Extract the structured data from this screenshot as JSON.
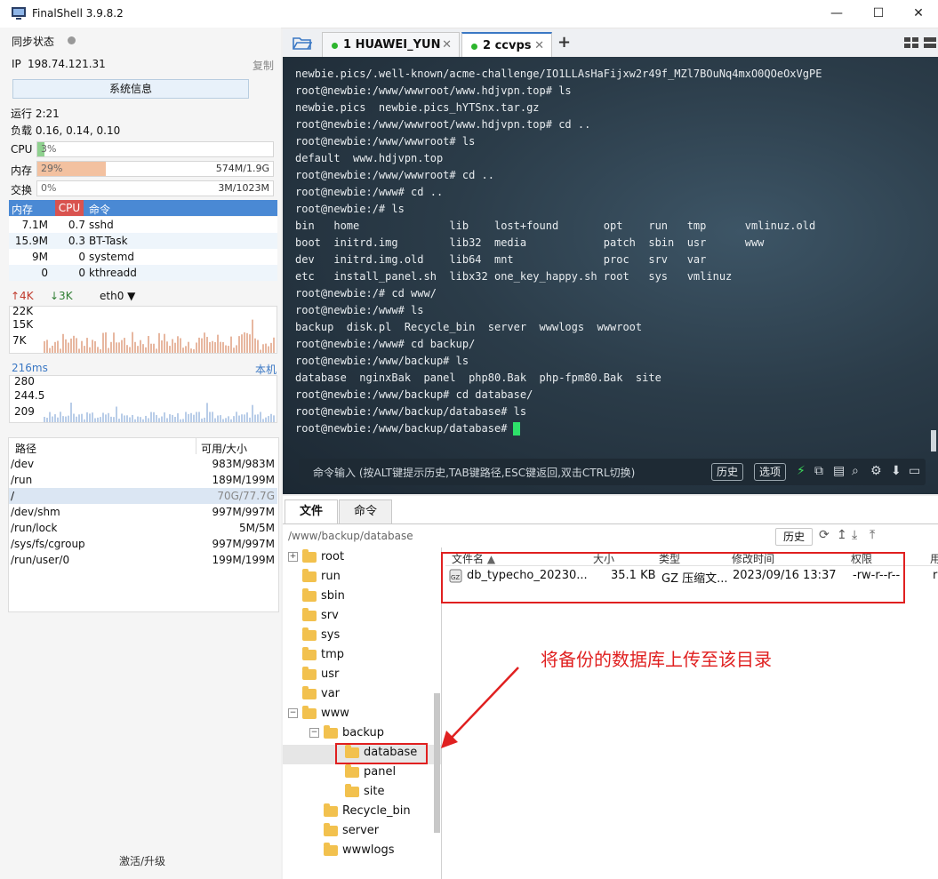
{
  "window": {
    "title": "FinalShell 3.9.8.2",
    "minimize": "—",
    "maximize": "☐",
    "close": "✕"
  },
  "left": {
    "sync_label": "同步状态",
    "ip_label": "IP",
    "ip": "198.74.121.31",
    "copy": "复制",
    "sysinfo_button": "系统信息",
    "uptime": "运行 2:21",
    "load": "负载 0.16, 0.14, 0.10",
    "cpu_label": "CPU",
    "cpu_percent": "3%",
    "cpu_fraction": 0.03,
    "mem_label": "内存",
    "mem_percent": "29%",
    "mem_fraction": 0.29,
    "mem_amount": "574M/1.9G",
    "swap_label": "交换",
    "swap_percent": "0%",
    "swap_amount": "3M/1023M",
    "proc_headers": [
      "内存",
      "CPU",
      "命令"
    ],
    "processes": [
      {
        "mem": "7.1M",
        "cpu": "0.7",
        "cmd": "sshd"
      },
      {
        "mem": "15.9M",
        "cpu": "0.3",
        "cmd": "BT-Task"
      },
      {
        "mem": "9M",
        "cpu": "0",
        "cmd": "systemd"
      },
      {
        "mem": "0",
        "cpu": "0",
        "cmd": "kthreadd"
      }
    ],
    "net_up": "↑4K",
    "net_down": "↓3K",
    "iface": "eth0",
    "net_ticks": [
      "22K",
      "15K",
      "7K"
    ],
    "ping_ms": "216ms",
    "ping_target": "本机",
    "ping_ticks": [
      "280",
      "244.5",
      "209"
    ],
    "disk_headers": [
      "路径",
      "可用/大小"
    ],
    "disks": [
      {
        "path": "/dev",
        "size": "983M/983M"
      },
      {
        "path": "/run",
        "size": "189M/199M"
      },
      {
        "path": "/",
        "size": "70G/77.7G"
      },
      {
        "path": "/dev/shm",
        "size": "997M/997M"
      },
      {
        "path": "/run/lock",
        "size": "5M/5M"
      },
      {
        "path": "/sys/fs/cgroup",
        "size": "997M/997M"
      },
      {
        "path": "/run/user/0",
        "size": "199M/199M"
      }
    ],
    "activate": "激活/升级"
  },
  "tabs": [
    {
      "label": "1  HUAWEI_YUN",
      "close": "✕"
    },
    {
      "label": "2  ccvps",
      "close": "✕"
    }
  ],
  "add_tab": "+",
  "terminal": {
    "lines": [
      "newbie.pics/.well-known/acme-challenge/IO1LLAsHaFijxw2r49f_MZl7BOuNq4mxO0QOeOxVgPE",
      "root@newbie:/www/wwwroot/www.hdjvpn.top# ls",
      "newbie.pics  newbie.pics_hYTSnx.tar.gz",
      "root@newbie:/www/wwwroot/www.hdjvpn.top# cd ..",
      "root@newbie:/www/wwwroot# ls",
      "default  www.hdjvpn.top",
      "root@newbie:/www/wwwroot# cd ..",
      "root@newbie:/www# cd ..",
      "root@newbie:/# ls",
      "bin   home              lib    lost+found       opt    run   tmp      vmlinuz.old",
      "boot  initrd.img        lib32  media            patch  sbin  usr      www",
      "dev   initrd.img.old    lib64  mnt              proc   srv   var",
      "etc   install_panel.sh  libx32 one_key_happy.sh root   sys   vmlinuz",
      "root@newbie:/# cd www/",
      "root@newbie:/www# ls",
      "backup  disk.pl  Recycle_bin  server  wwwlogs  wwwroot",
      "root@newbie:/www# cd backup/",
      "root@newbie:/www/backup# ls",
      "database  nginxBak  panel  php80.Bak  php-fpm80.Bak  site",
      "root@newbie:/www/backup# cd database/",
      "root@newbie:/www/backup/database# ls",
      "root@newbie:/www/backup/database# "
    ],
    "cmd_hint": "命令输入 (按ALT键提示历史,TAB键路径,ESC键返回,双击CTRL切换)",
    "history_btn": "历史",
    "options_btn": "选项"
  },
  "files": {
    "tab_files": "文件",
    "tab_cmd": "命令",
    "path": "/www/backup/database",
    "history_btn": "历史",
    "tree": [
      {
        "name": "root",
        "level": 0
      },
      {
        "name": "run",
        "level": 0
      },
      {
        "name": "sbin",
        "level": 0
      },
      {
        "name": "srv",
        "level": 0
      },
      {
        "name": "sys",
        "level": 0
      },
      {
        "name": "tmp",
        "level": 0
      },
      {
        "name": "usr",
        "level": 0
      },
      {
        "name": "var",
        "level": 0
      },
      {
        "name": "www",
        "level": 0
      },
      {
        "name": "backup",
        "level": 1
      },
      {
        "name": "database",
        "level": 2
      },
      {
        "name": "panel",
        "level": 2
      },
      {
        "name": "site",
        "level": 2
      },
      {
        "name": "Recycle_bin",
        "level": 1
      },
      {
        "name": "server",
        "level": 1
      },
      {
        "name": "wwwlogs",
        "level": 1
      }
    ],
    "columns": [
      "文件名",
      "大小",
      "类型",
      "修改时间",
      "权限",
      "用"
    ],
    "rows": [
      {
        "name": "db_typecho_20230...",
        "size": "35.1 KB",
        "type": "GZ 压缩文...",
        "mtime": "2023/09/16 13:37",
        "perm": "-rw-r--r--",
        "extra": "r"
      }
    ],
    "annotation": "将备份的数据库上传至该目录"
  },
  "colors": {
    "accent": "#3b78c4",
    "mem_fill": "#f3c1a0",
    "cpu_fill": "#8fd18f",
    "annotation": "#e02020"
  }
}
